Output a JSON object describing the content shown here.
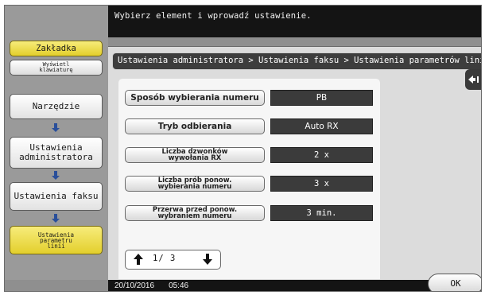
{
  "header": {
    "message": "Wybierz element i wprowadź ustawienie."
  },
  "sidebar": {
    "tab_label": "Zakładka",
    "keyboard_line1": "Wyświetl",
    "keyboard_line2": "klawiaturę",
    "breadcrumbs": {
      "item1": "Narzędzie",
      "item2_line1": "Ustawienia",
      "item2_line2": "administratora",
      "item3": "Ustawienia faksu",
      "item4_line1": "Ustawienia",
      "item4_line2": "parametru",
      "item4_line3": "linii"
    }
  },
  "main": {
    "breadcrumb": "Ustawienia administratora > Ustawienia faksu > Ustawienia parametrów linii",
    "rows": [
      {
        "label": "Sposób wybierania numeru",
        "value": "PB"
      },
      {
        "label": "Tryb odbierania",
        "value": "Auto RX"
      },
      {
        "label_line1": "Liczba dzwonków",
        "label_line2": "wywołania RX",
        "value": "2 x"
      },
      {
        "label_line1": "Liczba prób ponow.",
        "label_line2": "wybierania numeru",
        "value": "3 x"
      },
      {
        "label_line1": "Przerwa przed ponow.",
        "label_line2": "wybraniem numeru",
        "value": "3 min."
      }
    ],
    "pager": {
      "current": "1",
      "total": "3"
    }
  },
  "status": {
    "date": "20/10/2016",
    "time": "05:46"
  },
  "ok_label": "OK",
  "colors": {
    "accent_yellow": "#e9d640",
    "dark_bar": "#141414",
    "value_bg": "#3b3b3b",
    "arrow_blue": "#2a4f9a"
  }
}
